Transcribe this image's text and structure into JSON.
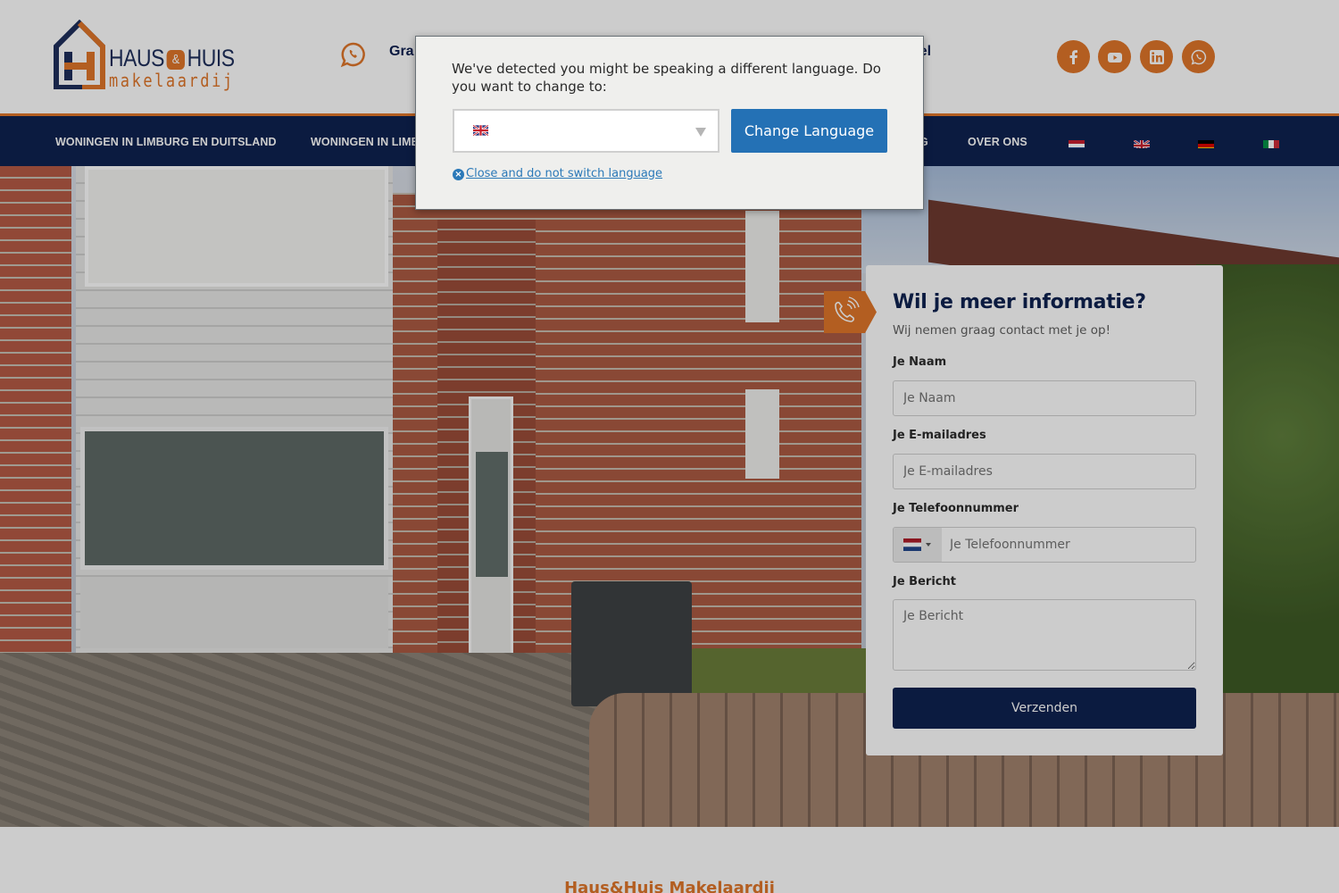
{
  "header": {
    "logo": {
      "brand_left": "HAUS",
      "brand_amp": "&",
      "brand_right": "HUIS",
      "tagline": "makelaardij"
    },
    "contact_partial_left": "Gra",
    "contact_partial_right": "bel",
    "social": [
      {
        "name": "facebook",
        "icon": "facebook-icon"
      },
      {
        "name": "youtube",
        "icon": "youtube-icon"
      },
      {
        "name": "linkedin",
        "icon": "linkedin-icon"
      },
      {
        "name": "whatsapp",
        "icon": "whatsapp-icon"
      }
    ],
    "accent_color": "#e0762a",
    "brand_navy": "#0e2250"
  },
  "nav": {
    "items": [
      {
        "label": "WONINGEN IN LIMBURG EN DUITSLAND"
      },
      {
        "label": "WONINGEN IN LIMB"
      },
      {
        "label": "G"
      },
      {
        "label": "OVER ONS"
      }
    ],
    "flags": [
      {
        "lang": "nl",
        "icon": "flag-nl-icon"
      },
      {
        "lang": "en",
        "icon": "flag-uk-icon"
      },
      {
        "lang": "de",
        "icon": "flag-de-icon"
      },
      {
        "lang": "it",
        "icon": "flag-it-icon"
      }
    ]
  },
  "form": {
    "title": "Wil je meer informatie?",
    "subtitle": "Wij nemen graag contact met je op!",
    "fields": {
      "name": {
        "label": "Je Naam",
        "placeholder": "Je Naam",
        "value": ""
      },
      "email": {
        "label": "Je E-mailadres",
        "placeholder": "Je E-mailadres",
        "value": ""
      },
      "phone": {
        "label": "Je Telefoonnummer",
        "placeholder": "Je Telefoonnummer",
        "value": "",
        "country": "nl"
      },
      "message": {
        "label": "Je Bericht",
        "placeholder": "Je Bericht",
        "value": ""
      }
    },
    "submit_label": "Verzenden"
  },
  "footer": {
    "title": "Haus&Huis Makelaardij"
  },
  "language_modal": {
    "message": "We've detected you might be speaking a different language. Do you want to change to:",
    "selected_language": "en",
    "selected_flag_icon": "flag-uk-icon",
    "change_button": "Change Language",
    "close_label": "Close and do not switch language",
    "button_color": "#2471b5"
  }
}
